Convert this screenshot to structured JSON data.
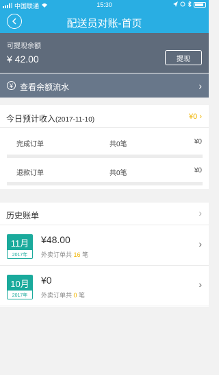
{
  "status_bar": {
    "carrier": "中国联通",
    "time": "15:30"
  },
  "nav": {
    "title": "配送员对账-首页"
  },
  "balance": {
    "label": "可提现余额",
    "amount": "¥ 42.00",
    "withdraw_label": "提现"
  },
  "flow": {
    "label": "查看余额流水"
  },
  "today": {
    "title": "今日预计收入",
    "date": "(2017-11-10)",
    "total": "¥0",
    "rows": [
      {
        "name": "完成订单",
        "count": "共0笔",
        "amount": "¥0"
      },
      {
        "name": "退款订单",
        "count": "共0笔",
        "amount": "¥0"
      }
    ]
  },
  "history": {
    "title": "历史账单",
    "bills": [
      {
        "month": "11月",
        "year": "2017年",
        "amount": "¥48.00",
        "sub_prefix": "外卖订单共 ",
        "sub_count": "16",
        "sub_suffix": " 笔"
      },
      {
        "month": "10月",
        "year": "2017年",
        "amount": "¥0",
        "sub_prefix": "外卖订单共 ",
        "sub_count": "0",
        "sub_suffix": " 笔"
      }
    ]
  },
  "colors": {
    "primary": "#29aee3",
    "balance_bg": "#5f6b7b",
    "accent_yellow": "#f0b400",
    "badge_green": "#1aaa9c"
  }
}
